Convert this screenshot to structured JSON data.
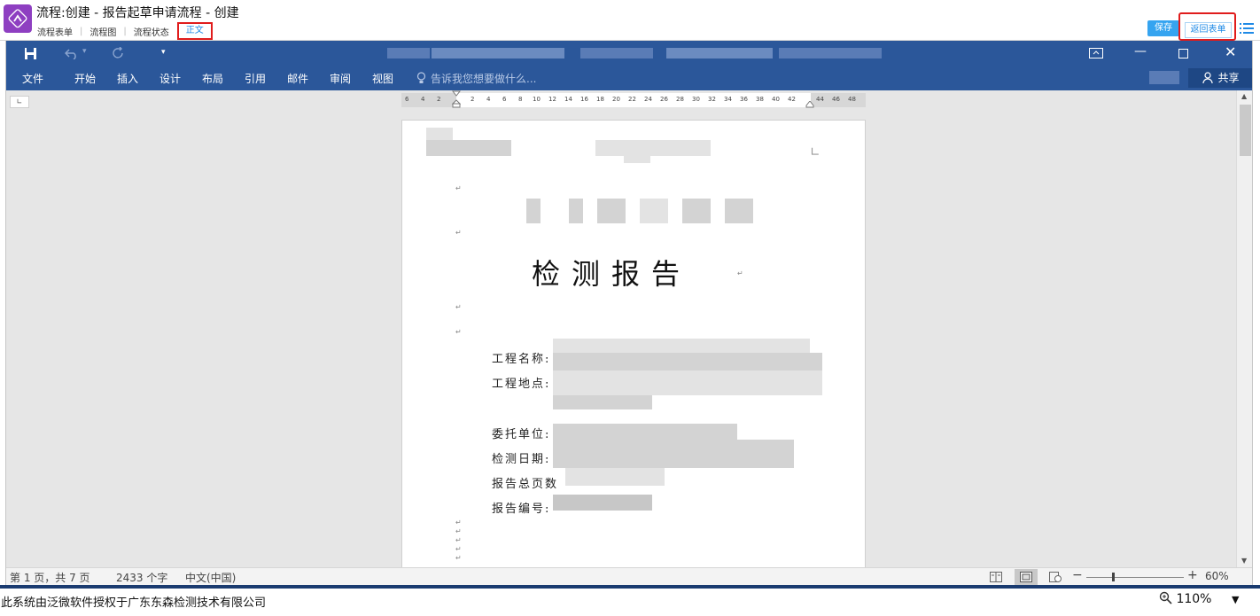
{
  "header": {
    "title": "流程:创建 - 报告起草申请流程 - 创建",
    "tabs": [
      {
        "label": "流程表单"
      },
      {
        "label": "流程图"
      },
      {
        "label": "流程状态"
      },
      {
        "label": "正文"
      }
    ],
    "active_tab": "正文",
    "save_label": "保存",
    "return_label": "返回表单"
  },
  "word": {
    "ribbon_tabs": [
      "文件",
      "开始",
      "插入",
      "设计",
      "布局",
      "引用",
      "邮件",
      "审阅",
      "视图"
    ],
    "tell_me_placeholder": "告诉我您想要做什么...",
    "share_label": "共享",
    "ruler_numbers": [
      "6",
      "4",
      "2",
      "2",
      "4",
      "6",
      "8",
      "10",
      "12",
      "14",
      "16",
      "18",
      "20",
      "22",
      "24",
      "26",
      "28",
      "30",
      "32",
      "34",
      "36",
      "38",
      "40",
      "42",
      "44",
      "46",
      "48"
    ],
    "document": {
      "title": "检测报告",
      "fields": [
        {
          "label": "工程名称:"
        },
        {
          "label": "工程地点:"
        },
        {
          "label": "委托单位:"
        },
        {
          "label": "检测日期:"
        },
        {
          "label": "报告总页数"
        },
        {
          "label": "报告编号:"
        }
      ]
    },
    "status": {
      "page_info": "第 1 页，共 7 页",
      "word_count": "2433 个字",
      "language": "中文(中国)",
      "zoom": "60%"
    }
  },
  "footer": {
    "license_text": "此系统由泛微软件授权于广东东森检测技术有限公司",
    "zoom": "110%"
  },
  "colors": {
    "word_blue": "#2b579a",
    "highlight_red": "#e01c1c",
    "save_blue": "#35a4f0",
    "logo_purple": "#8e3fc1"
  }
}
